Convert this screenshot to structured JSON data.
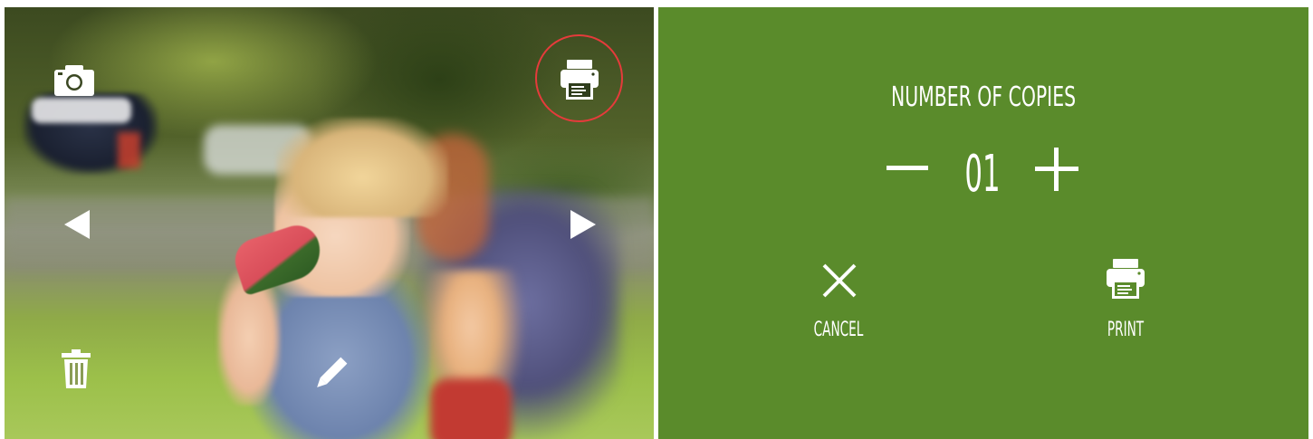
{
  "photo_view": {
    "icons": {
      "camera": "camera-icon",
      "printer": "printer-icon",
      "previous": "chevron-left-icon",
      "next": "chevron-right-icon",
      "delete": "trash-icon",
      "edit": "pencil-icon"
    },
    "highlight_color": "#e53b3b"
  },
  "print_dialog": {
    "title": "NUMBER OF COPIES",
    "copies": "01",
    "decrement_icon": "minus-icon",
    "increment_icon": "plus-icon",
    "cancel_label": "CANCEL",
    "print_label": "PRINT",
    "background_color": "#5a8b2b"
  }
}
